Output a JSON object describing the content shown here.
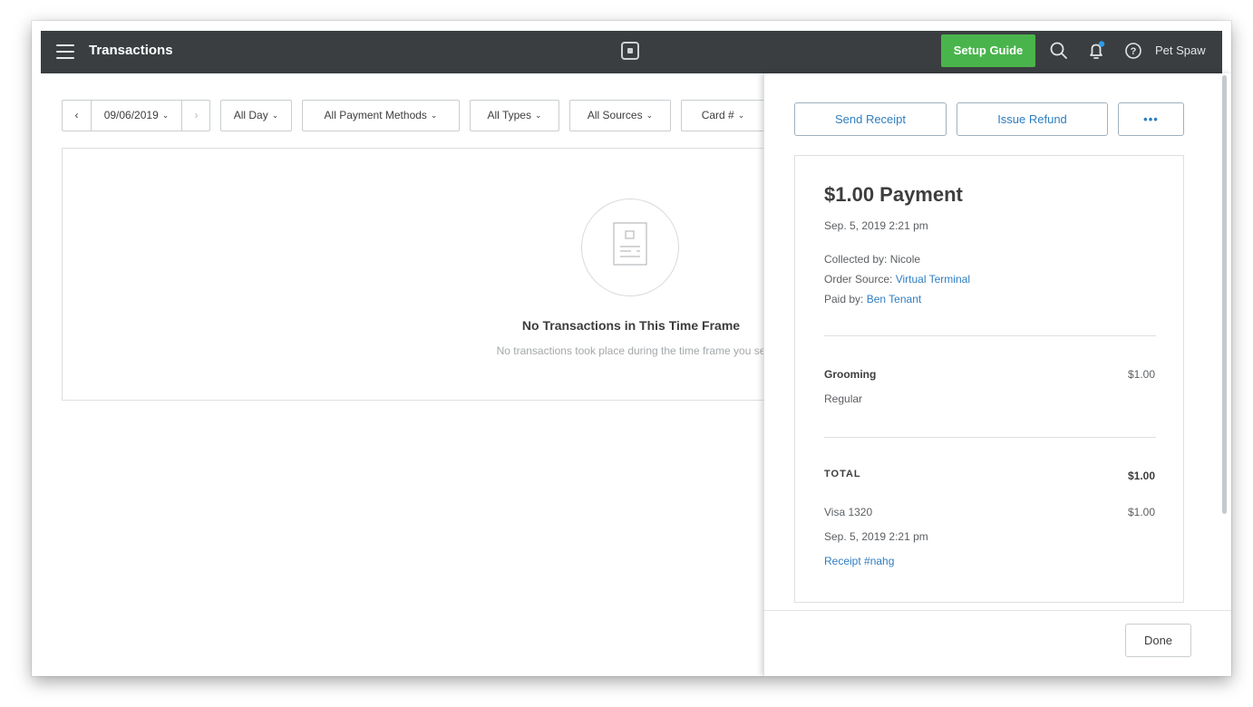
{
  "header": {
    "title": "Transactions",
    "setup_guide": "Setup Guide",
    "user": "Pet Spaw"
  },
  "filters": {
    "date": "09/06/2019",
    "prev_icon": "chevron-left-icon",
    "next_icon": "chevron-right-icon",
    "time": "All Day",
    "payment_methods": "All Payment Methods",
    "types": "All Types",
    "sources": "All Sources",
    "card": "Card #"
  },
  "empty_state": {
    "title": "No Transactions in This Time Frame",
    "subtitle": "No transactions took place during the time frame you se"
  },
  "drawer": {
    "actions": {
      "send_receipt": "Send Receipt",
      "issue_refund": "Issue Refund",
      "more": "•••"
    },
    "payment": {
      "title": "$1.00 Payment",
      "datetime": "Sep. 5, 2019 2:21 pm",
      "collected_label": "Collected by:",
      "collected_by": "Nicole",
      "order_source_label": "Order Source:",
      "order_source": "Virtual Terminal",
      "paid_by_label": "Paid by:",
      "paid_by": "Ben Tenant"
    },
    "item": {
      "name": "Grooming",
      "variant": "Regular",
      "price": "$1.00"
    },
    "total": {
      "label": "TOTAL",
      "amount": "$1.00"
    },
    "tender": {
      "card": "Visa 1320",
      "amount": "$1.00",
      "datetime": "Sep. 5, 2019 2:21 pm",
      "receipt": "Receipt #nahg"
    },
    "done": "Done"
  },
  "colors": {
    "topbar": "#3a3e41",
    "setup_green": "#4ab44c",
    "link_blue": "#2f7ec0",
    "notification_dot": "#2d9be8"
  }
}
